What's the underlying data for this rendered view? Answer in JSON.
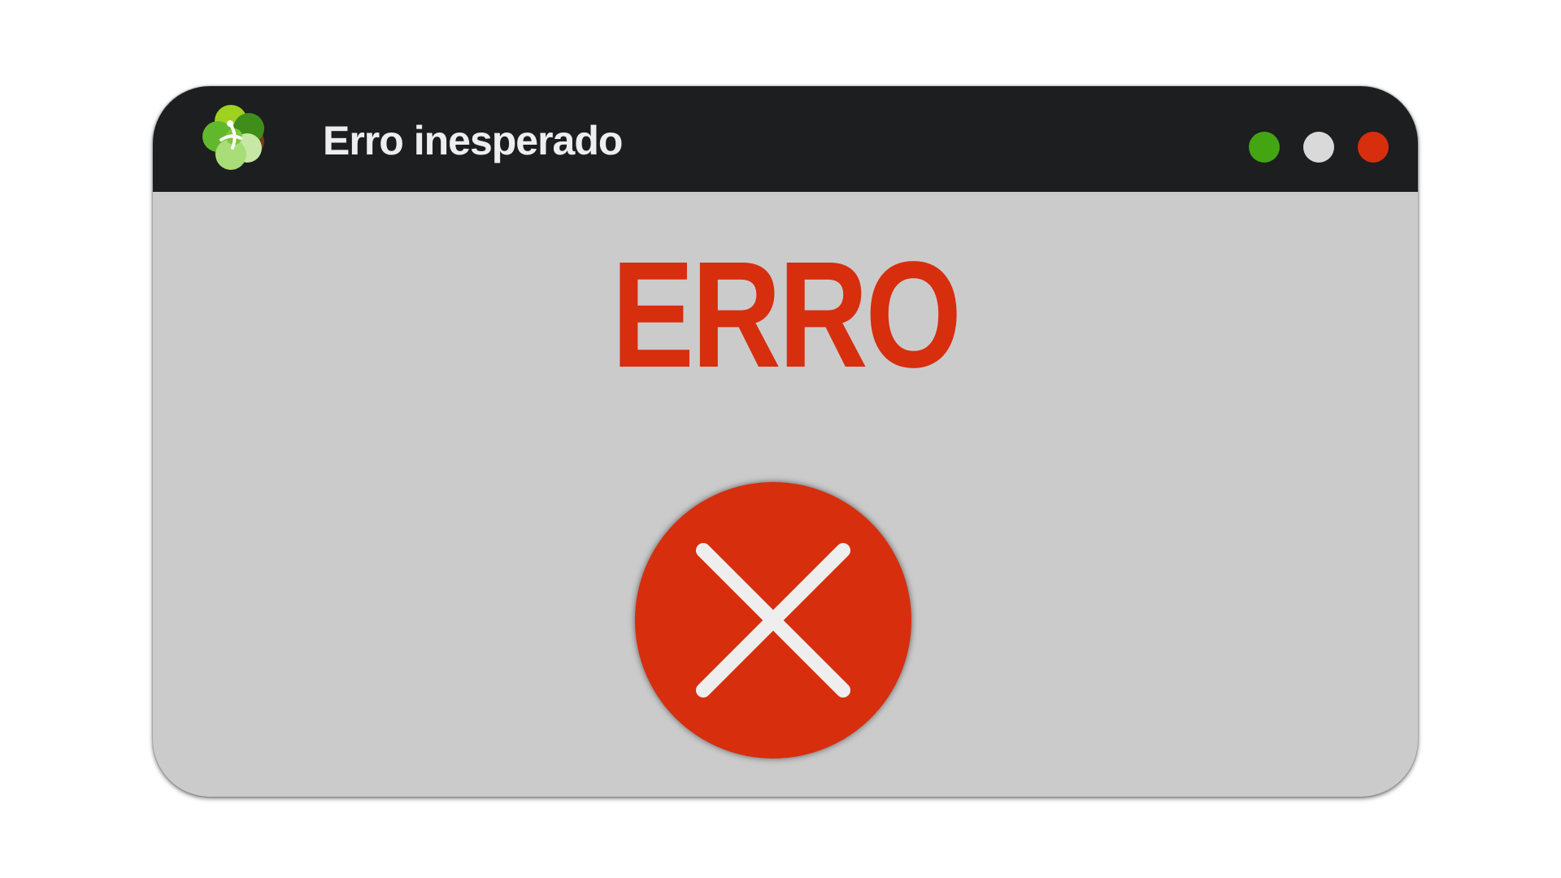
{
  "window": {
    "title": "Erro inesperado",
    "logo_icon": "green-flower-logo-icon",
    "controls": {
      "minimize": {
        "icon": "minimize-dot-icon",
        "color": "#44a512"
      },
      "maximize": {
        "icon": "maximize-dot-icon",
        "color": "#d9d9d9"
      },
      "close": {
        "icon": "close-dot-icon",
        "color": "#d72e0e"
      }
    }
  },
  "content": {
    "heading": "ERRO",
    "heading_color": "#d72e0e",
    "error_icon": "error-x-circle-icon",
    "error_icon_color": "#d72e0e",
    "error_icon_mark_color": "#eeeeee"
  },
  "colors": {
    "titlebar": "#1d1e20",
    "window_body": "#cbcbcb",
    "page_background": "#ffffff"
  }
}
